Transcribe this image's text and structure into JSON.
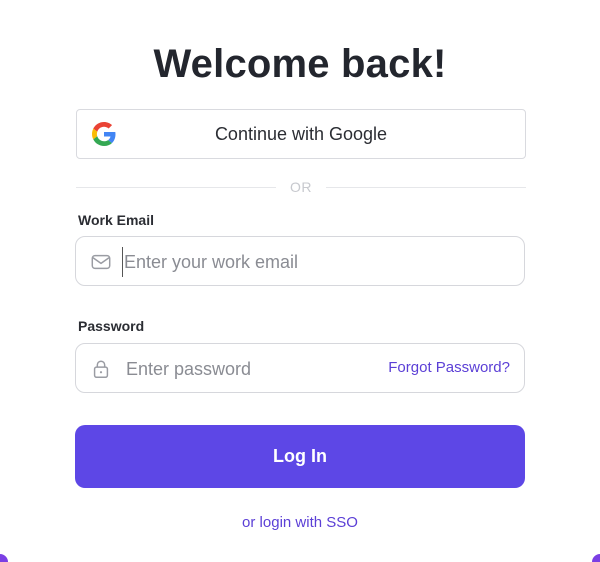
{
  "page": {
    "title": "Welcome back!"
  },
  "google_button": {
    "label": "Continue with Google",
    "icon": "google-logo-icon"
  },
  "divider": {
    "text": "OR"
  },
  "email": {
    "label": "Work Email",
    "placeholder": "Enter your work email",
    "value": "",
    "icon": "envelope-icon"
  },
  "password": {
    "label": "Password",
    "placeholder": "Enter password",
    "value": "",
    "icon": "lock-icon",
    "forgot_label": "Forgot Password?"
  },
  "login_button": {
    "label": "Log In"
  },
  "sso_link": {
    "label": "or login with SSO"
  },
  "colors": {
    "primary": "#5d47e6",
    "link": "#5b3fd6",
    "heading": "#23262e",
    "border": "#d6d7dc"
  }
}
